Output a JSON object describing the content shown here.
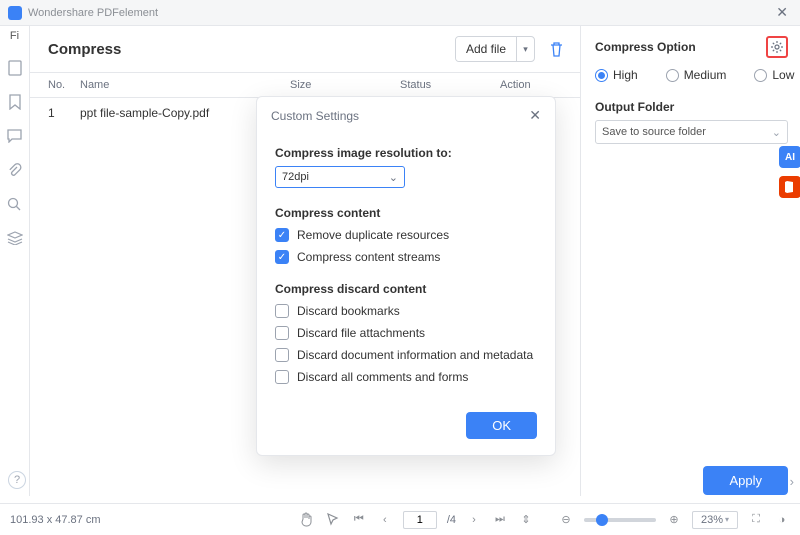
{
  "titlebar": {
    "app": "Wondershare PDFelement"
  },
  "leftstrip": {
    "top_label": "Fi"
  },
  "header": {
    "title": "Compress",
    "add_file": "Add file"
  },
  "table": {
    "cols": {
      "no": "No.",
      "name": "Name",
      "size": "Size",
      "status": "Status",
      "action": "Action"
    },
    "rows": [
      {
        "no": "1",
        "name": "ppt file-sample-Copy.pdf",
        "size": "",
        "status": "",
        "action": ""
      }
    ]
  },
  "rightpanel": {
    "title": "Compress Option",
    "options": {
      "high": "High",
      "medium": "Medium",
      "low": "Low"
    },
    "selected": "high",
    "output_folder_label": "Output Folder",
    "output_folder_value": "Save to source folder",
    "apply": "Apply"
  },
  "modal": {
    "title": "Custom Settings",
    "res_label": "Compress image resolution to:",
    "res_value": "72dpi",
    "content_label": "Compress content",
    "content_items": [
      {
        "label": "Remove duplicate resources",
        "checked": true
      },
      {
        "label": "Compress content streams",
        "checked": true
      }
    ],
    "discard_label": "Compress discard content",
    "discard_items": [
      {
        "label": "Discard bookmarks",
        "checked": false
      },
      {
        "label": "Discard file attachments",
        "checked": false
      },
      {
        "label": "Discard document information and metadata",
        "checked": false
      },
      {
        "label": "Discard all comments and forms",
        "checked": false
      }
    ],
    "ok": "OK"
  },
  "footer": {
    "dims": "101.93 x 47.87 cm",
    "page": "1",
    "pages": "/4",
    "zoom": "23%"
  }
}
